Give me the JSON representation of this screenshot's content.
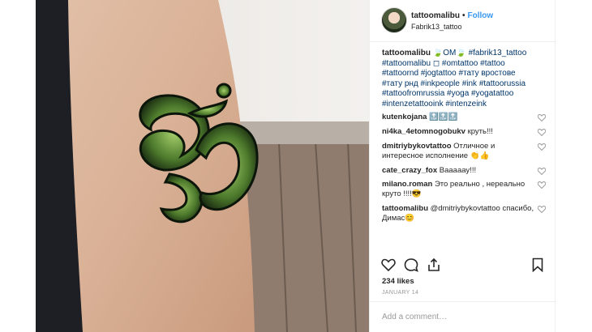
{
  "post": {
    "username": "tattoomalibu",
    "follow_label": "Follow",
    "location": "Fabrik13_tattoo",
    "caption_user": "tattoomalibu",
    "caption_lines": [
      "🍃OM🍃 #fabrik13_tattoo",
      "#tattoomalibu ◻ #omtattoo #tattoo",
      "#tattoornd #jogtattoo #тату вростове",
      "#тату рнд #inkpeople #ink #tattoorussia",
      "#tattoofromrussia #yoga #yogatattoo",
      "#intenzetattooink #intenzeink"
    ],
    "likes": "234 likes",
    "date": "JANUARY 14",
    "add_comment_placeholder": "Add a comment…"
  },
  "comments": [
    {
      "user": "kutenkojana",
      "text": "🔝🔝🔝"
    },
    {
      "user": "ni4ka_4etomnogobukv",
      "text": "круть!!!"
    },
    {
      "user": "dmitriybykovtattoo",
      "text": "Отличное и интересное исполнение 👏👍"
    },
    {
      "user": "cate_crazy_fox",
      "text": "Вааааау!!!"
    },
    {
      "user": "milano.roman",
      "text": "Это реально , нереально круто !!!!😎"
    },
    {
      "user": "tattoomalibu",
      "text": "@dmitriybykovtattoo спасибо, Димас😊"
    }
  ],
  "icons": {
    "avatar": "avatar-image",
    "like": "heart-icon",
    "comment": "comment-bubble-icon",
    "share": "share-icon",
    "save": "bookmark-icon"
  },
  "colors": {
    "link": "#3897f0",
    "hashtag": "#003569",
    "muted": "#999999",
    "tattoo_green": "#5d8a3a"
  }
}
